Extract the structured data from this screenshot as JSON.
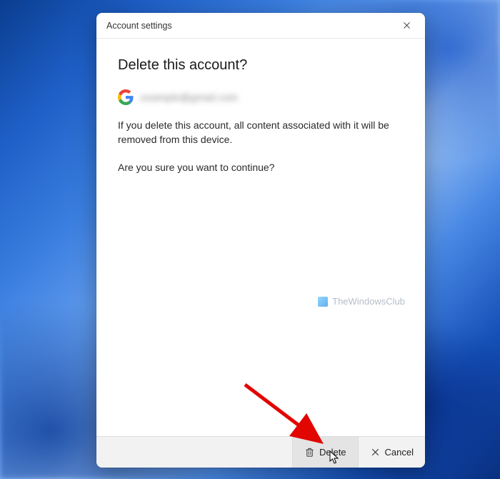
{
  "titlebar": {
    "title": "Account settings"
  },
  "dialog": {
    "heading": "Delete this account?",
    "account_email": "example@gmail.com",
    "warning_text": "If you delete this account, all content associated with it will be removed from this device.",
    "confirm_text": "Are you sure you want to continue?",
    "watermark": "TheWindowsClub"
  },
  "footer": {
    "delete_label": "Delete",
    "cancel_label": "Cancel"
  },
  "icons": {
    "close": "close-icon",
    "google": "google-logo-icon",
    "trash": "trash-icon",
    "cancel_x": "x-icon"
  }
}
